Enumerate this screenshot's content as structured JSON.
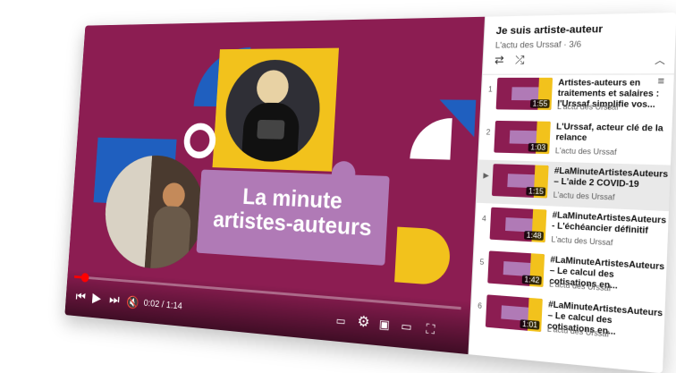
{
  "player": {
    "title_line1": "La minute",
    "title_line2": "artistes-auteurs",
    "time": "0:02 / 1:14",
    "progress_fraction": 0.03,
    "accent_color": "#8c1d52",
    "yellow": "#f2c21c",
    "blue": "#1f5fbf",
    "purple": "#b07ab6"
  },
  "playlist": {
    "title": "Je suis artiste-auteur",
    "subtitle": "L'actu des Urssaf · 3/6",
    "items": [
      {
        "index": "1",
        "title": "Artistes-auteurs en traitements et salaires : l'Urssaf simplifie vos...",
        "channel": "L'actu des Urssaf",
        "duration": "1:55"
      },
      {
        "index": "2",
        "title": "L'Urssaf, acteur clé de la relance",
        "channel": "L'actu des Urssaf",
        "duration": "1:03"
      },
      {
        "index": "▶",
        "title": "#LaMinuteArtistesAuteurs – L'aide 2 COVID-19",
        "channel": "L'actu des Urssaf",
        "duration": "1:15"
      },
      {
        "index": "4",
        "title": "#LaMinuteArtistesAuteurs - L'échéancier définitif",
        "channel": "L'actu des Urssaf",
        "duration": "1:48"
      },
      {
        "index": "5",
        "title": "#LaMinuteArtistesAuteurs – Le calcul des cotisations en...",
        "channel": "L'actu des Urssaf",
        "duration": "1:42"
      },
      {
        "index": "6",
        "title": "#LaMinuteArtistesAuteurs – Le calcul des cotisations en...",
        "channel": "L'actu des Urssaf",
        "duration": "1:01"
      }
    ]
  }
}
